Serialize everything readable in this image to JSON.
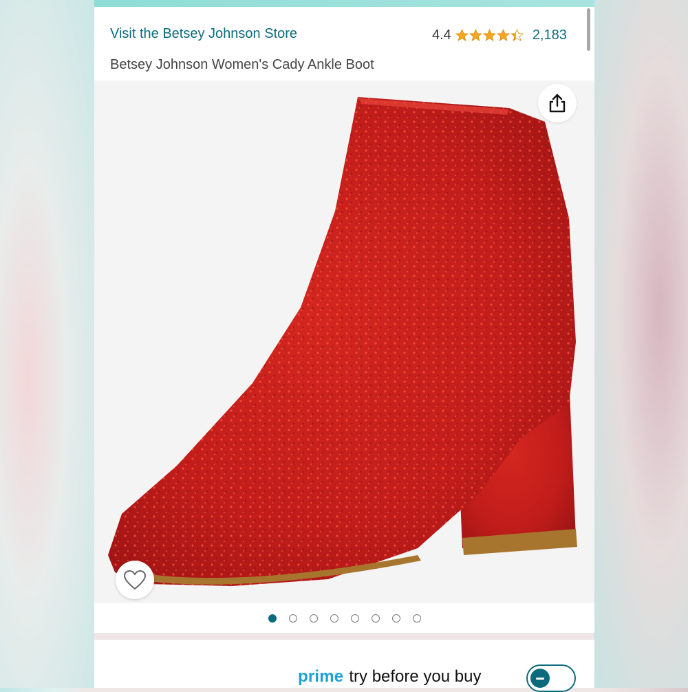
{
  "header": {
    "store_link": "Visit the Betsey Johnson Store",
    "rating_value": "4.4",
    "rating_stars": 4.4,
    "rating_count": "2,183",
    "product_title": "Betsey Johnson Women's Cady Ankle Boot"
  },
  "gallery": {
    "image_subject": "red rhinestone ankle boot",
    "image_count": 8,
    "active_index": 0,
    "share_icon": "share-icon",
    "wishlist_icon": "heart-outline-icon"
  },
  "prime": {
    "brand": "prime",
    "label": "try before you buy",
    "toggle_state": "on"
  },
  "colors": {
    "accent": "#0b6b7d",
    "prime_blue": "#1ba2d6",
    "star": "#f5a623",
    "boot_red": "#c8201e"
  }
}
